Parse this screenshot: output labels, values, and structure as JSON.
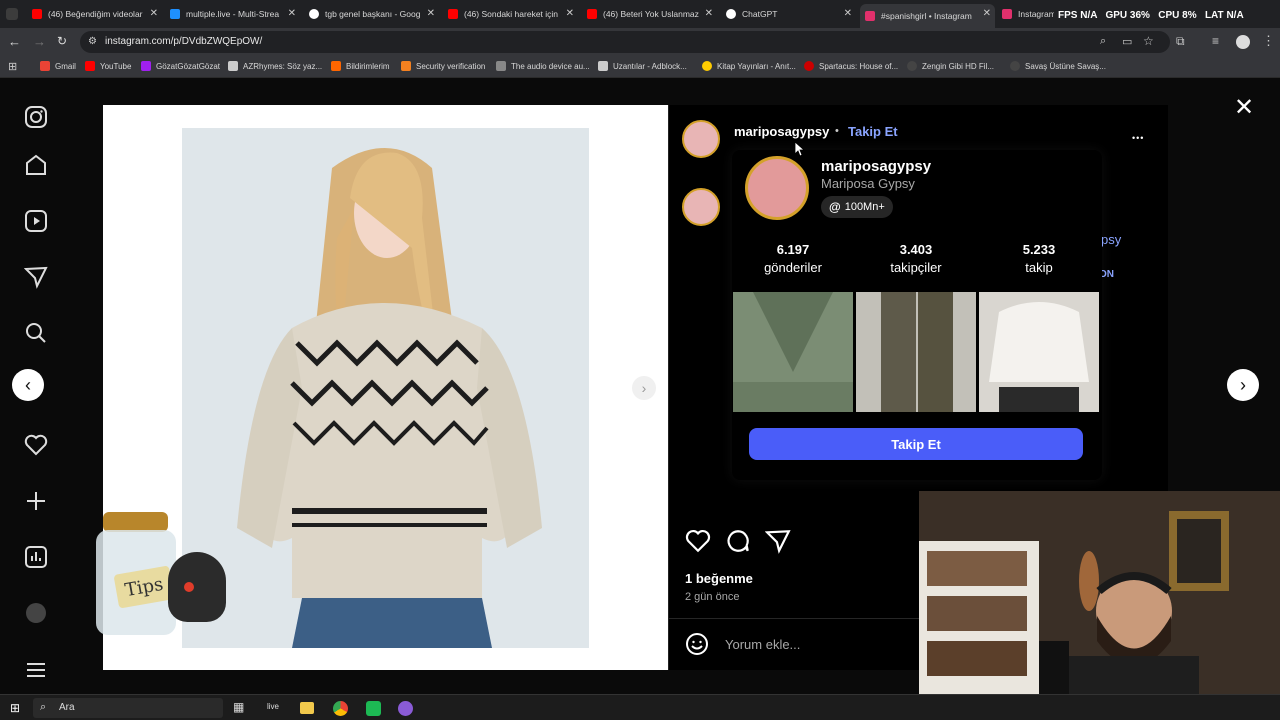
{
  "tabs": [
    {
      "label": "(46) Beğendiğim videolar",
      "color": "#ff0000"
    },
    {
      "label": "multiple.live - Multi-Strea",
      "color": "#1e90ff"
    },
    {
      "label": "tgb genel başkanı - Goog",
      "color": "#ffffff"
    },
    {
      "label": "(46) Sondaki hareket için",
      "color": "#ff0000"
    },
    {
      "label": "(46) Beteri Yok Uslanmaz",
      "color": "#ff0000"
    },
    {
      "label": "ChatGPT",
      "color": "#ffffff"
    },
    {
      "label": "#spanishgirl • Instagram",
      "color": "#e1306c"
    },
    {
      "label": "Instagram",
      "color": "#e1306c"
    }
  ],
  "stats": {
    "fps_label": "FPS",
    "fps_val": "N/A",
    "gpu_label": "GPU",
    "gpu_val": "36%",
    "cpu_label": "CPU",
    "cpu_val": "8%",
    "lat_label": "LAT",
    "lat_val": "N/A"
  },
  "url": "instagram.com/p/DVdbZWQEpOW/",
  "bookmarks": [
    {
      "label": "Gmail",
      "color": "#ea4335"
    },
    {
      "label": "YouTube",
      "color": "#ff0000"
    },
    {
      "label": "GözatGözatGözat",
      "color": "#a020f0"
    },
    {
      "label": "AZRhymes: Söz yaz...",
      "color": "#cccccc"
    },
    {
      "label": "Bildirimlerim",
      "color": "#ff6600"
    },
    {
      "label": "Security verification",
      "color": "#f48120"
    },
    {
      "label": "The audio device au...",
      "color": "#888888"
    },
    {
      "label": "Uzantılar - Adblock...",
      "color": "#cccccc"
    },
    {
      "label": "Kitap Yayınları - Anıt...",
      "color": "#ffcc00"
    },
    {
      "label": "Spartacus: House of...",
      "color": "#cc0000"
    },
    {
      "label": "Zengin Gibi HD Fil...",
      "color": "#333333"
    },
    {
      "label": "Savaş Üstüne Savaş...",
      "color": "#333333"
    }
  ],
  "post": {
    "username": "mariposagypsy",
    "separator": "•",
    "follow_link": "Takip Et",
    "more": "•••",
    "likes": "1 beğenme",
    "time": "2 gün önce",
    "comment_placeholder": "Yorum ekle...",
    "partial_name": "psy",
    "partial_on": "ON"
  },
  "hovercard": {
    "username": "mariposagypsy",
    "full_name": "Mariposa Gypsy",
    "threads": "100Mn+",
    "posts": "6.197",
    "posts_label": "gönderiler",
    "followers": "3.403",
    "followers_label": "takipçiler",
    "following": "5.233",
    "following_label": "takip",
    "follow_button": "Takip Et"
  },
  "tips_label": "Tips",
  "search_label": "Ara",
  "live_label": "live",
  "colors": {
    "accent": "#4a5df9",
    "link": "#8aa4ff"
  },
  "icons": [
    "instagram-icon",
    "home-icon",
    "reels-icon",
    "messages-icon",
    "search-icon",
    "explore-icon",
    "heart-icon",
    "create-icon",
    "insights-icon",
    "profile-icon",
    "menu-icon"
  ]
}
